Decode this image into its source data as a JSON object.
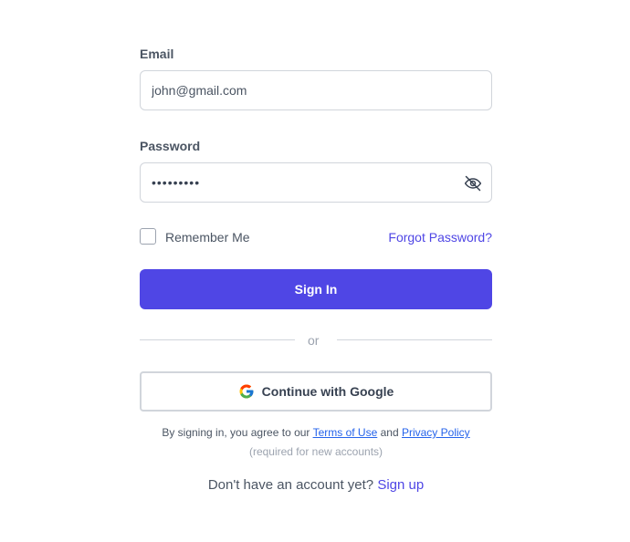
{
  "email": {
    "label": "Email",
    "value": "john@gmail.com"
  },
  "password": {
    "label": "Password",
    "masked_value": "•••••••••",
    "toggle_icon": "eye-off-icon"
  },
  "remember": {
    "label": "Remember Me",
    "checked": false
  },
  "forgot_link": "Forgot Password?",
  "signin_button": "Sign In",
  "divider_text": "or",
  "google_button": {
    "label": "Continue with Google",
    "icon": "google-logo-icon"
  },
  "terms": {
    "prefix": "By signing in, you agree to our",
    "terms_link": "Terms of Use",
    "and": "and",
    "privacy_link": "Privacy Policy",
    "note": "(required for new accounts)"
  },
  "signup": {
    "prompt": "Don't have an account yet?",
    "link": "Sign up"
  },
  "colors": {
    "primary": "#4f46e5",
    "link": "#2563eb",
    "border": "#d1d5db"
  }
}
